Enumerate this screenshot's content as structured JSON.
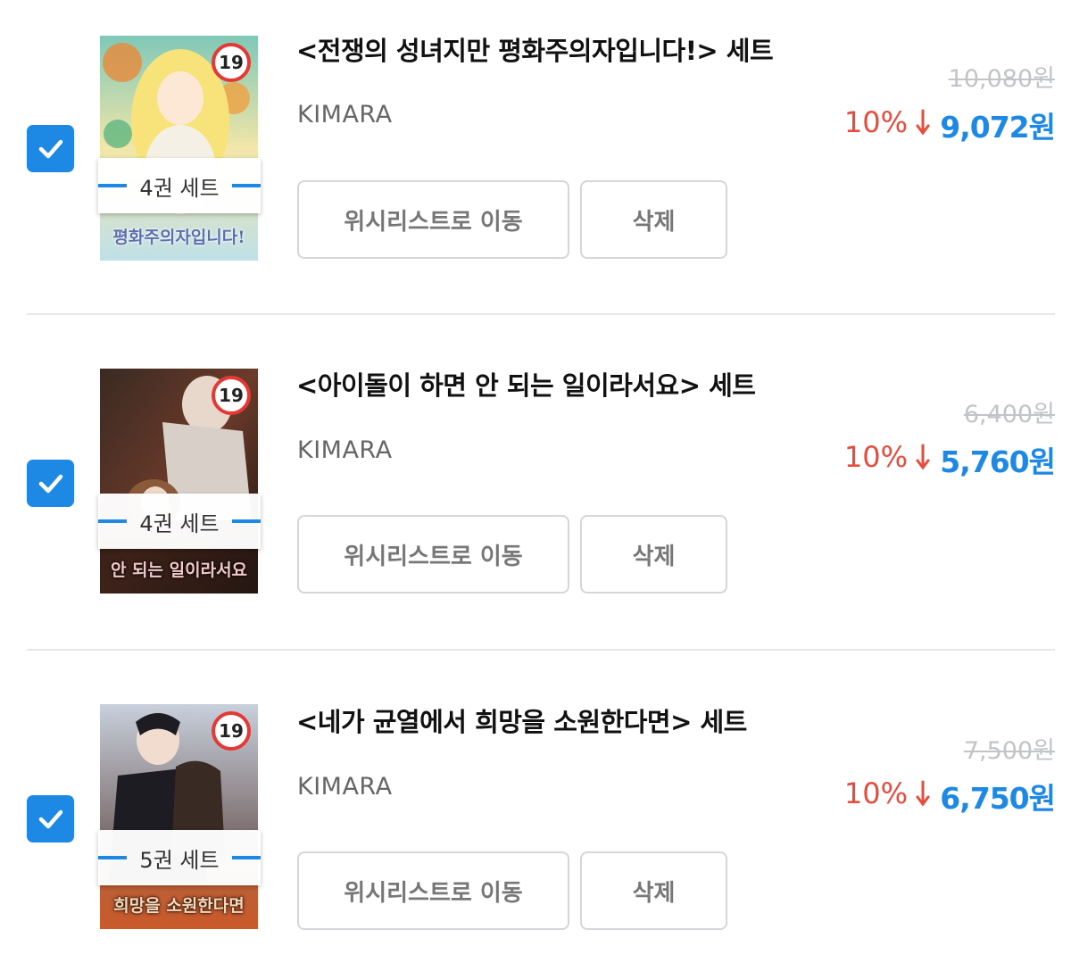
{
  "items": [
    {
      "checked": true,
      "age_rating": "19",
      "cover_text": "평화주의자입니다!",
      "set_label": "4권 세트",
      "title": "<전쟁의 성녀지만 평화주의자입니다!> 세트",
      "author": "KIMARA",
      "wishlist_label": "위시리스트로 이동",
      "delete_label": "삭제",
      "original_price": "10,080원",
      "discount": "10%",
      "sale_price": "9,072원"
    },
    {
      "checked": true,
      "age_rating": "19",
      "cover_text": "안 되는 일이라서요",
      "set_label": "4권 세트",
      "title": "<아이돌이 하면 안 되는 일이라서요> 세트",
      "author": "KIMARA",
      "wishlist_label": "위시리스트로 이동",
      "delete_label": "삭제",
      "original_price": "6,400원",
      "discount": "10%",
      "sale_price": "5,760원"
    },
    {
      "checked": true,
      "age_rating": "19",
      "cover_text": "희망을 소원한다면",
      "set_label": "5권 세트",
      "title": "<네가 균열에서 희망을 소원한다면> 세트",
      "author": "KIMARA",
      "wishlist_label": "위시리스트로 이동",
      "delete_label": "삭제",
      "original_price": "7,500원",
      "discount": "10%",
      "sale_price": "6,750원"
    }
  ],
  "colors": {
    "accent_blue": "#1e88e5",
    "discount_red": "#e74c3c",
    "strike_gray": "#c2c4c8",
    "divider": "#e6e7ea"
  },
  "icons": {
    "checkbox": "checkmark-icon",
    "discount": "arrow-down-icon",
    "age": "age-19-badge-icon"
  }
}
